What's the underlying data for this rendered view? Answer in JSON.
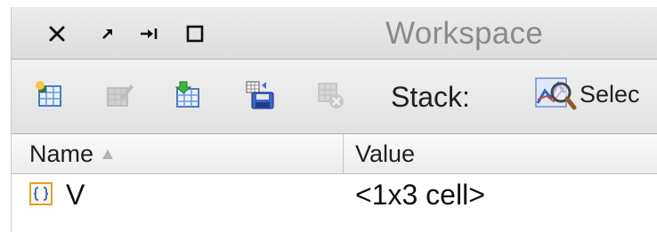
{
  "window": {
    "title": "Workspace",
    "controls": {
      "close_icon": "close-icon",
      "undock_icon": "undock-arrow-icon",
      "minimize_icon": "minimize-to-edge-icon",
      "maximize_icon": "maximize-square-icon"
    }
  },
  "toolbar": {
    "buttons": [
      {
        "name": "new-variable",
        "icon": "new-variable-icon",
        "enabled": true
      },
      {
        "name": "open-selection",
        "icon": "open-selection-icon",
        "enabled": false
      },
      {
        "name": "load-data",
        "icon": "load-data-icon",
        "enabled": true
      },
      {
        "name": "save-workspace",
        "icon": "save-workspace-icon",
        "enabled": true
      },
      {
        "name": "delete-variable",
        "icon": "delete-variable-icon",
        "enabled": false
      }
    ],
    "stack_label": "Stack:",
    "select_label": "Selec",
    "select_icon": "magnifier-plot-icon"
  },
  "table": {
    "columns": [
      {
        "key": "name",
        "label": "Name",
        "sort": "ascending"
      },
      {
        "key": "value",
        "label": "Value"
      }
    ],
    "rows": [
      {
        "icon": "cell-array-icon",
        "name": "V",
        "value": "<1x3 cell>"
      }
    ]
  },
  "colors": {
    "title_text": "#8a8a8a",
    "toolbar_bg": "#e8e8e8",
    "cell_icon_border": "#e0a030",
    "cell_icon_glyph": "#3a6fd8"
  }
}
